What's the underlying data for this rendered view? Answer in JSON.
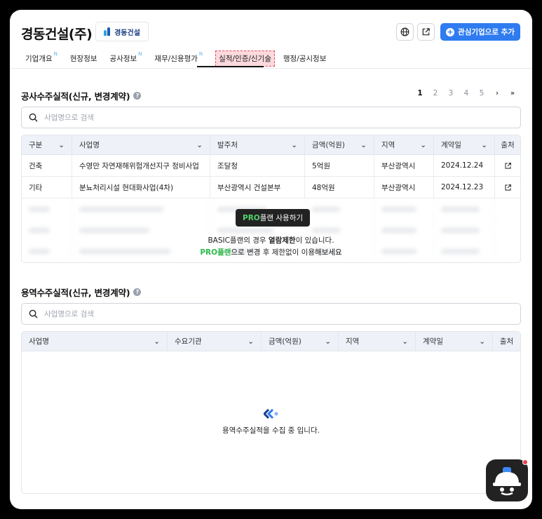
{
  "header": {
    "company_name": "경동건설(주)",
    "logo_text": "경동건설",
    "add_interest_label": "관심기업으로 추가"
  },
  "tabs": [
    {
      "label": "기업개요",
      "badge": "N"
    },
    {
      "label": "현장정보",
      "badge": ""
    },
    {
      "label": "공사정보",
      "badge": "N"
    },
    {
      "label": "재무/신용평가",
      "badge": "N"
    },
    {
      "label": "실적/인증/신기술",
      "badge": "",
      "active": true
    },
    {
      "label": "행정/공시정보",
      "badge": ""
    }
  ],
  "construction": {
    "title": "공사수주실적(신규, 변경계약)",
    "pagination": [
      "1",
      "2",
      "3",
      "4",
      "5"
    ],
    "search_placeholder": "사업명으로 검색",
    "columns": [
      "구분",
      "사업명",
      "발주처",
      "금액(억원)",
      "지역",
      "계약일",
      "출처"
    ],
    "rows": [
      {
        "type": "건축",
        "name": "수영만 자연재해위험개선지구 정비사업",
        "client": "조달청",
        "amount": "5억원",
        "region": "부산광역시",
        "date": "2024.12.24"
      },
      {
        "type": "기타",
        "name": "분뇨처리시설 현대화사업(4차)",
        "client": "부산광역시 건설본부",
        "amount": "48억원",
        "region": "부산광역시",
        "date": "2024.12.23"
      }
    ],
    "pro_button": {
      "pro": "PRO",
      "rest": "플랜 사용하기"
    },
    "restrict_line1": {
      "pre": "BASIC플랜의 경우 ",
      "bold": "열람제한",
      "post": "이 있습니다."
    },
    "restrict_line2": {
      "green": "PRO플랜",
      "post": "으로 변경 후 제한없이 이용해보세요"
    }
  },
  "service": {
    "title": "용역수주실적(신규, 변경계약)",
    "search_placeholder": "사업명으로 검색",
    "columns": [
      "사업명",
      "수요기관",
      "금액(억원)",
      "지역",
      "계약일",
      "출처"
    ],
    "empty_message": "용역수주실적을 수집 중 입니다."
  },
  "colors": {
    "accent": "#2f7bf0",
    "pro_green": "#2cba48",
    "active_tab_bg": "#fbd9dd"
  }
}
